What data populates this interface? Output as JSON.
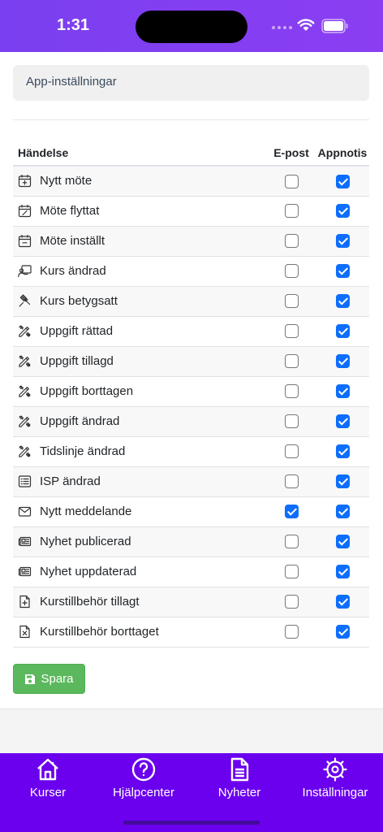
{
  "status_bar": {
    "time": "1:31"
  },
  "section": {
    "title": "App-inställningar"
  },
  "table": {
    "headers": {
      "event": "Händelse",
      "email": "E-post",
      "push": "Appnotis"
    },
    "rows": [
      {
        "label": "Nytt möte",
        "icon": "calendar-plus-icon",
        "email": false,
        "push": true
      },
      {
        "label": "Möte flyttat",
        "icon": "calendar-edit-icon",
        "email": false,
        "push": true
      },
      {
        "label": "Möte inställt",
        "icon": "calendar-minus-icon",
        "email": false,
        "push": true
      },
      {
        "label": "Kurs ändrad",
        "icon": "teacher-board-icon",
        "email": false,
        "push": true
      },
      {
        "label": "Kurs betygsatt",
        "icon": "gavel-icon",
        "email": false,
        "push": true
      },
      {
        "label": "Uppgift rättad",
        "icon": "pencil-ruler-icon",
        "email": false,
        "push": true
      },
      {
        "label": "Uppgift tillagd",
        "icon": "pencil-ruler-icon",
        "email": false,
        "push": true
      },
      {
        "label": "Uppgift borttagen",
        "icon": "pencil-ruler-icon",
        "email": false,
        "push": true
      },
      {
        "label": "Uppgift ändrad",
        "icon": "pencil-ruler-icon",
        "email": false,
        "push": true
      },
      {
        "label": "Tidslinje ändrad",
        "icon": "pencil-ruler-icon",
        "email": false,
        "push": true
      },
      {
        "label": "ISP ändrad",
        "icon": "list-icon",
        "email": false,
        "push": true
      },
      {
        "label": "Nytt meddelande",
        "icon": "envelope-icon",
        "email": true,
        "push": true
      },
      {
        "label": "Nyhet publicerad",
        "icon": "newspaper-icon",
        "email": false,
        "push": true
      },
      {
        "label": "Nyhet uppdaterad",
        "icon": "newspaper-icon",
        "email": false,
        "push": true
      },
      {
        "label": "Kurstillbehör tillagt",
        "icon": "file-plus-icon",
        "email": false,
        "push": true
      },
      {
        "label": "Kurstillbehör borttaget",
        "icon": "file-x-icon",
        "email": false,
        "push": true
      }
    ]
  },
  "save_button": {
    "label": "Spara",
    "icon": "floppy-disk-icon"
  },
  "tabbar": {
    "items": [
      {
        "label": "Kurser",
        "icon": "house-icon"
      },
      {
        "label": "Hjälpcenter",
        "icon": "question-circle-icon"
      },
      {
        "label": "Nyheter",
        "icon": "document-icon"
      },
      {
        "label": "Inställningar",
        "icon": "gear-icon"
      }
    ]
  },
  "colors": {
    "header_bg": "#7a3ff0",
    "tabbar_bg": "#6a00ee",
    "checkbox": "#0d6efd",
    "save_button": "#5cb85c"
  }
}
